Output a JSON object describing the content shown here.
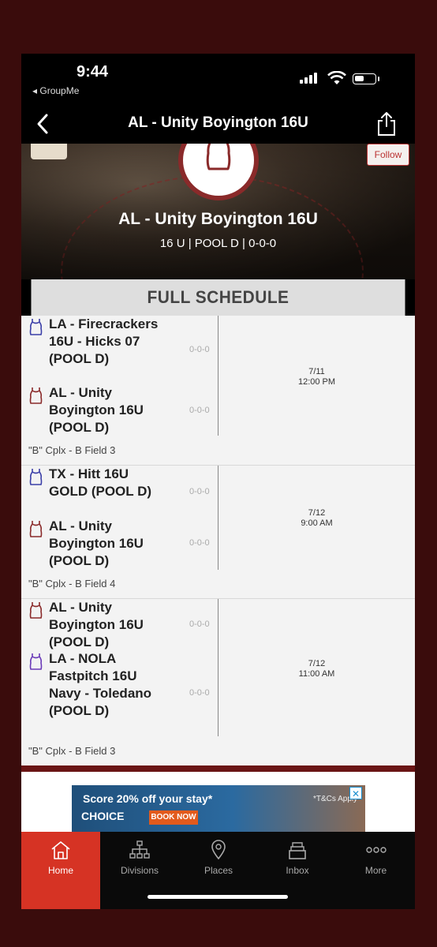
{
  "status_bar": {
    "time": "9:44",
    "back_app": "◂ GroupMe"
  },
  "nav": {
    "title": "AL - Unity Boyington 16U"
  },
  "header": {
    "follow_label": "Follow",
    "team_name": "AL - Unity Boyington 16U",
    "team_meta": "16 U | POOL D | 0-0-0"
  },
  "schedule": {
    "title": "FULL SCHEDULE",
    "games": [
      {
        "home": {
          "name": "LA - Firecrackers 16U - Hicks 07 (POOL D)",
          "record": "0-0-0",
          "jersey_color": "#3b3fa8"
        },
        "away": {
          "name": "AL - Unity Boyington 16U (POOL D)",
          "record": "0-0-0",
          "jersey_color": "#8a2a2a"
        },
        "date": "7/11",
        "time": "12:00 PM",
        "field": "\"B\" Cplx - B Field 3"
      },
      {
        "home": {
          "name": "TX - Hitt 16U GOLD (POOL D)",
          "record": "0-0-0",
          "jersey_color": "#3b3fa8"
        },
        "away": {
          "name": "AL - Unity Boyington 16U (POOL D)",
          "record": "0-0-0",
          "jersey_color": "#8a2a2a"
        },
        "date": "7/12",
        "time": "9:00 AM",
        "field": "\"B\" Cplx - B Field 4"
      },
      {
        "home": {
          "name": "AL - Unity Boyington 16U (POOL D)",
          "record": "0-0-0",
          "jersey_color": "#8a2a2a"
        },
        "away": {
          "name": "LA - NOLA Fastpitch 16U Navy - Toledano (POOL D)",
          "record": "0-0-0",
          "jersey_color": "#6a3ab8"
        },
        "date": "7/12",
        "time": "11:00 AM",
        "field": "\"B\" Cplx - B Field 3"
      }
    ]
  },
  "ad": {
    "headline": "Score 20% off your stay*",
    "terms": "*T&Cs Apply",
    "brand": "CHOICE",
    "cta": "BOOK NOW"
  },
  "tabs": [
    {
      "label": "Home",
      "icon": "home-icon",
      "active": true
    },
    {
      "label": "Divisions",
      "icon": "divisions-icon",
      "active": false
    },
    {
      "label": "Places",
      "icon": "location-pin-icon",
      "active": false
    },
    {
      "label": "Inbox",
      "icon": "inbox-icon",
      "active": false
    },
    {
      "label": "More",
      "icon": "more-icon",
      "active": false
    }
  ],
  "colors": {
    "accent": "#d63324",
    "brand_maroon": "#8a2a2a"
  }
}
